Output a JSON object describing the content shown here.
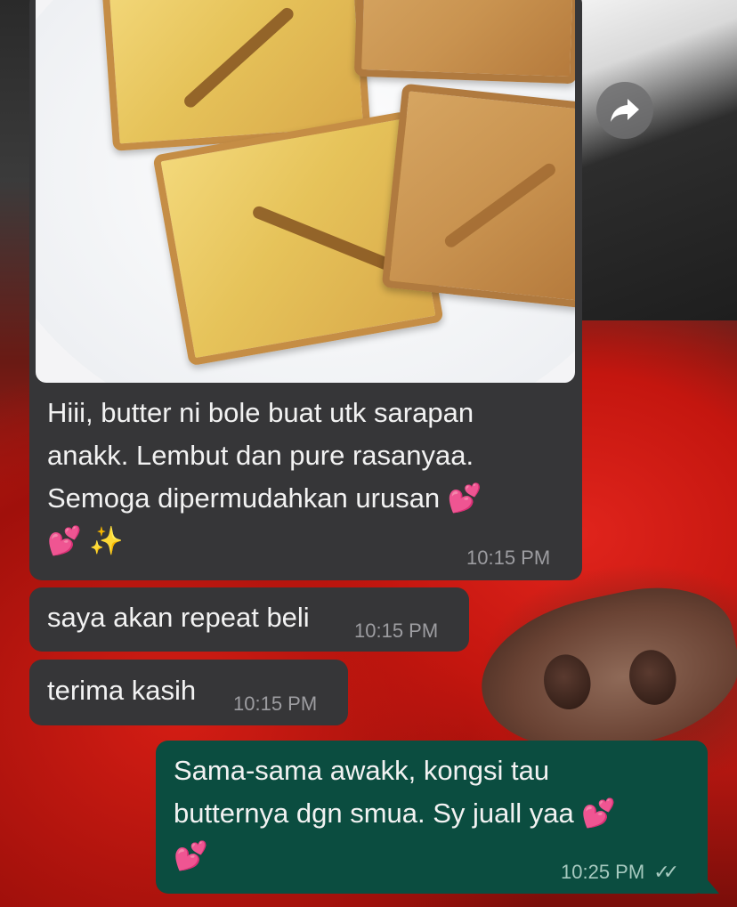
{
  "chat": {
    "incoming_media": {
      "image_alt": "butter toast on white plate",
      "caption_lines": [
        "Hiii, butter ni bole buat utk sarapan",
        "anakk. Lembut dan pure rasanyaa.",
        "Semoga dipermudahkan urusan"
      ],
      "emoji_pair": "💕",
      "sparkles": "✨",
      "time": "10:15 PM"
    },
    "incoming_messages": [
      {
        "text": "saya akan repeat beli",
        "time": "10:15 PM"
      },
      {
        "text": "terima kasih",
        "time": "10:15 PM"
      }
    ],
    "outgoing_message": {
      "lines": [
        "Sama-sama awakk, kongsi tau",
        "butternya dgn smua. Sy juall yaa"
      ],
      "emoji": "💕",
      "time": "10:25 PM",
      "status": "read"
    },
    "forward_icon": "forward-arrow-icon"
  }
}
